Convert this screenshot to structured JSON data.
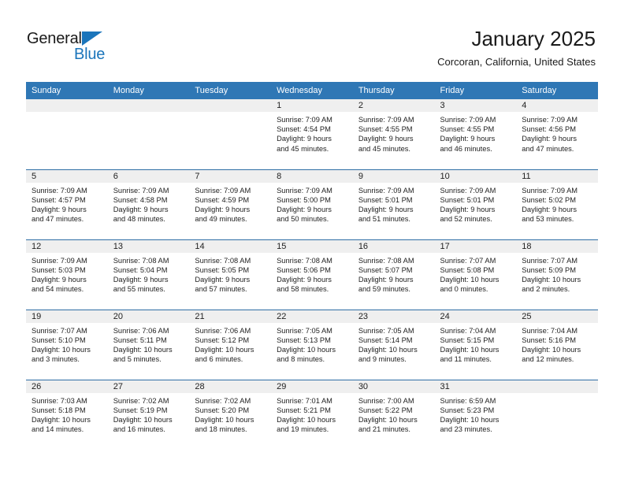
{
  "branding": {
    "name_top": "General",
    "name_bottom": "Blue"
  },
  "header": {
    "title": "January 2025",
    "subtitle": "Corcoran, California, United States"
  },
  "calendar": {
    "weekday_headers": [
      "Sunday",
      "Monday",
      "Tuesday",
      "Wednesday",
      "Thursday",
      "Friday",
      "Saturday"
    ],
    "header_color": "#2f77b5",
    "row_divider_color": "#2f6ea5",
    "daynum_strip_color": "#efefef",
    "weeks": [
      [
        {
          "day": "",
          "empty": true
        },
        {
          "day": "",
          "empty": true
        },
        {
          "day": "",
          "empty": true
        },
        {
          "day": "1",
          "sunrise": "Sunrise: 7:09 AM",
          "sunset": "Sunset: 4:54 PM",
          "daylight_1": "Daylight: 9 hours",
          "daylight_2": "and 45 minutes."
        },
        {
          "day": "2",
          "sunrise": "Sunrise: 7:09 AM",
          "sunset": "Sunset: 4:55 PM",
          "daylight_1": "Daylight: 9 hours",
          "daylight_2": "and 45 minutes."
        },
        {
          "day": "3",
          "sunrise": "Sunrise: 7:09 AM",
          "sunset": "Sunset: 4:55 PM",
          "daylight_1": "Daylight: 9 hours",
          "daylight_2": "and 46 minutes."
        },
        {
          "day": "4",
          "sunrise": "Sunrise: 7:09 AM",
          "sunset": "Sunset: 4:56 PM",
          "daylight_1": "Daylight: 9 hours",
          "daylight_2": "and 47 minutes."
        }
      ],
      [
        {
          "day": "5",
          "sunrise": "Sunrise: 7:09 AM",
          "sunset": "Sunset: 4:57 PM",
          "daylight_1": "Daylight: 9 hours",
          "daylight_2": "and 47 minutes."
        },
        {
          "day": "6",
          "sunrise": "Sunrise: 7:09 AM",
          "sunset": "Sunset: 4:58 PM",
          "daylight_1": "Daylight: 9 hours",
          "daylight_2": "and 48 minutes."
        },
        {
          "day": "7",
          "sunrise": "Sunrise: 7:09 AM",
          "sunset": "Sunset: 4:59 PM",
          "daylight_1": "Daylight: 9 hours",
          "daylight_2": "and 49 minutes."
        },
        {
          "day": "8",
          "sunrise": "Sunrise: 7:09 AM",
          "sunset": "Sunset: 5:00 PM",
          "daylight_1": "Daylight: 9 hours",
          "daylight_2": "and 50 minutes."
        },
        {
          "day": "9",
          "sunrise": "Sunrise: 7:09 AM",
          "sunset": "Sunset: 5:01 PM",
          "daylight_1": "Daylight: 9 hours",
          "daylight_2": "and 51 minutes."
        },
        {
          "day": "10",
          "sunrise": "Sunrise: 7:09 AM",
          "sunset": "Sunset: 5:01 PM",
          "daylight_1": "Daylight: 9 hours",
          "daylight_2": "and 52 minutes."
        },
        {
          "day": "11",
          "sunrise": "Sunrise: 7:09 AM",
          "sunset": "Sunset: 5:02 PM",
          "daylight_1": "Daylight: 9 hours",
          "daylight_2": "and 53 minutes."
        }
      ],
      [
        {
          "day": "12",
          "sunrise": "Sunrise: 7:09 AM",
          "sunset": "Sunset: 5:03 PM",
          "daylight_1": "Daylight: 9 hours",
          "daylight_2": "and 54 minutes."
        },
        {
          "day": "13",
          "sunrise": "Sunrise: 7:08 AM",
          "sunset": "Sunset: 5:04 PM",
          "daylight_1": "Daylight: 9 hours",
          "daylight_2": "and 55 minutes."
        },
        {
          "day": "14",
          "sunrise": "Sunrise: 7:08 AM",
          "sunset": "Sunset: 5:05 PM",
          "daylight_1": "Daylight: 9 hours",
          "daylight_2": "and 57 minutes."
        },
        {
          "day": "15",
          "sunrise": "Sunrise: 7:08 AM",
          "sunset": "Sunset: 5:06 PM",
          "daylight_1": "Daylight: 9 hours",
          "daylight_2": "and 58 minutes."
        },
        {
          "day": "16",
          "sunrise": "Sunrise: 7:08 AM",
          "sunset": "Sunset: 5:07 PM",
          "daylight_1": "Daylight: 9 hours",
          "daylight_2": "and 59 minutes."
        },
        {
          "day": "17",
          "sunrise": "Sunrise: 7:07 AM",
          "sunset": "Sunset: 5:08 PM",
          "daylight_1": "Daylight: 10 hours",
          "daylight_2": "and 0 minutes."
        },
        {
          "day": "18",
          "sunrise": "Sunrise: 7:07 AM",
          "sunset": "Sunset: 5:09 PM",
          "daylight_1": "Daylight: 10 hours",
          "daylight_2": "and 2 minutes."
        }
      ],
      [
        {
          "day": "19",
          "sunrise": "Sunrise: 7:07 AM",
          "sunset": "Sunset: 5:10 PM",
          "daylight_1": "Daylight: 10 hours",
          "daylight_2": "and 3 minutes."
        },
        {
          "day": "20",
          "sunrise": "Sunrise: 7:06 AM",
          "sunset": "Sunset: 5:11 PM",
          "daylight_1": "Daylight: 10 hours",
          "daylight_2": "and 5 minutes."
        },
        {
          "day": "21",
          "sunrise": "Sunrise: 7:06 AM",
          "sunset": "Sunset: 5:12 PM",
          "daylight_1": "Daylight: 10 hours",
          "daylight_2": "and 6 minutes."
        },
        {
          "day": "22",
          "sunrise": "Sunrise: 7:05 AM",
          "sunset": "Sunset: 5:13 PM",
          "daylight_1": "Daylight: 10 hours",
          "daylight_2": "and 8 minutes."
        },
        {
          "day": "23",
          "sunrise": "Sunrise: 7:05 AM",
          "sunset": "Sunset: 5:14 PM",
          "daylight_1": "Daylight: 10 hours",
          "daylight_2": "and 9 minutes."
        },
        {
          "day": "24",
          "sunrise": "Sunrise: 7:04 AM",
          "sunset": "Sunset: 5:15 PM",
          "daylight_1": "Daylight: 10 hours",
          "daylight_2": "and 11 minutes."
        },
        {
          "day": "25",
          "sunrise": "Sunrise: 7:04 AM",
          "sunset": "Sunset: 5:16 PM",
          "daylight_1": "Daylight: 10 hours",
          "daylight_2": "and 12 minutes."
        }
      ],
      [
        {
          "day": "26",
          "sunrise": "Sunrise: 7:03 AM",
          "sunset": "Sunset: 5:18 PM",
          "daylight_1": "Daylight: 10 hours",
          "daylight_2": "and 14 minutes."
        },
        {
          "day": "27",
          "sunrise": "Sunrise: 7:02 AM",
          "sunset": "Sunset: 5:19 PM",
          "daylight_1": "Daylight: 10 hours",
          "daylight_2": "and 16 minutes."
        },
        {
          "day": "28",
          "sunrise": "Sunrise: 7:02 AM",
          "sunset": "Sunset: 5:20 PM",
          "daylight_1": "Daylight: 10 hours",
          "daylight_2": "and 18 minutes."
        },
        {
          "day": "29",
          "sunrise": "Sunrise: 7:01 AM",
          "sunset": "Sunset: 5:21 PM",
          "daylight_1": "Daylight: 10 hours",
          "daylight_2": "and 19 minutes."
        },
        {
          "day": "30",
          "sunrise": "Sunrise: 7:00 AM",
          "sunset": "Sunset: 5:22 PM",
          "daylight_1": "Daylight: 10 hours",
          "daylight_2": "and 21 minutes."
        },
        {
          "day": "31",
          "sunrise": "Sunrise: 6:59 AM",
          "sunset": "Sunset: 5:23 PM",
          "daylight_1": "Daylight: 10 hours",
          "daylight_2": "and 23 minutes."
        },
        {
          "day": "",
          "empty": true
        }
      ]
    ]
  }
}
